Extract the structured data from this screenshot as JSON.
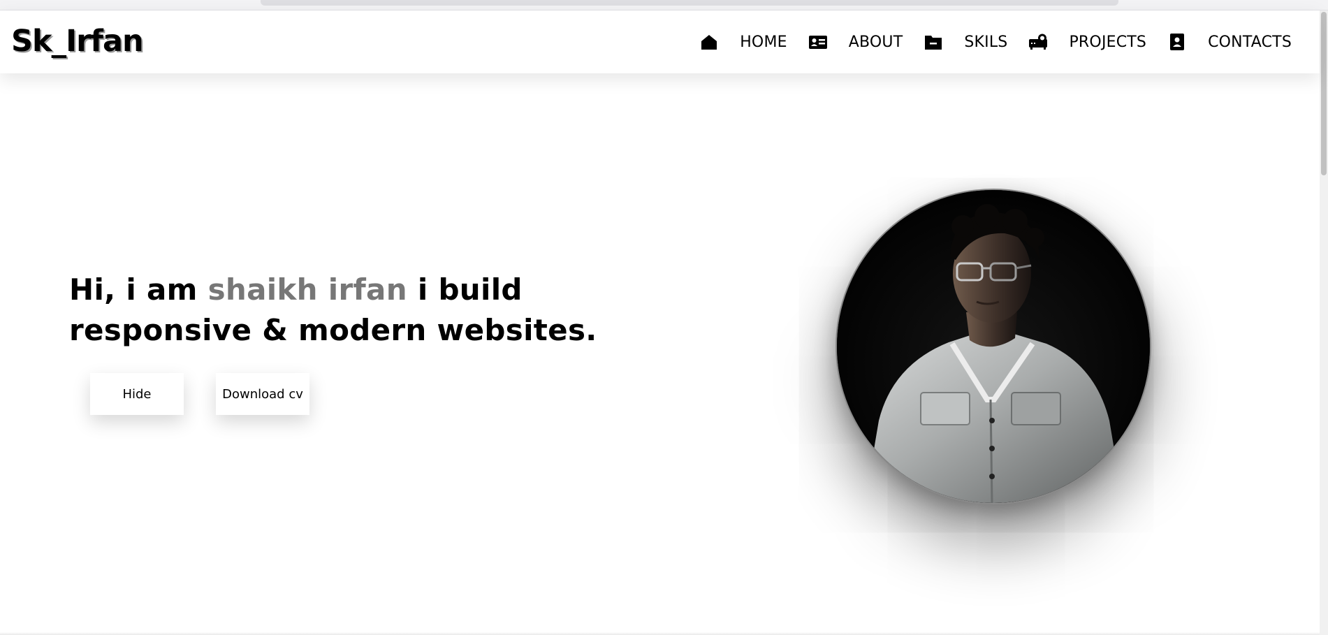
{
  "brand": {
    "logo_text": "Sk_Irfan"
  },
  "nav": {
    "items": [
      {
        "label": "HOME",
        "icon": "home-icon"
      },
      {
        "label": "ABOUT",
        "icon": "id-card-icon"
      },
      {
        "label": "SKILS",
        "icon": "folder-icon"
      },
      {
        "label": "PROJECTS",
        "icon": "projector-icon"
      },
      {
        "label": "CONTACTS",
        "icon": "address-book-icon"
      }
    ]
  },
  "hero": {
    "intro": "Hi, i am ",
    "name": "shaikh irfan",
    "line1_rest": " i build",
    "line2": "responsive & modern websites.",
    "buttons": {
      "hide_label": "Hide",
      "cv_label": "Download cv"
    }
  },
  "profile": {
    "image": "portrait-photo"
  },
  "colors": {
    "accent_name": "#777777",
    "text": "#000000",
    "background": "#ffffff"
  }
}
